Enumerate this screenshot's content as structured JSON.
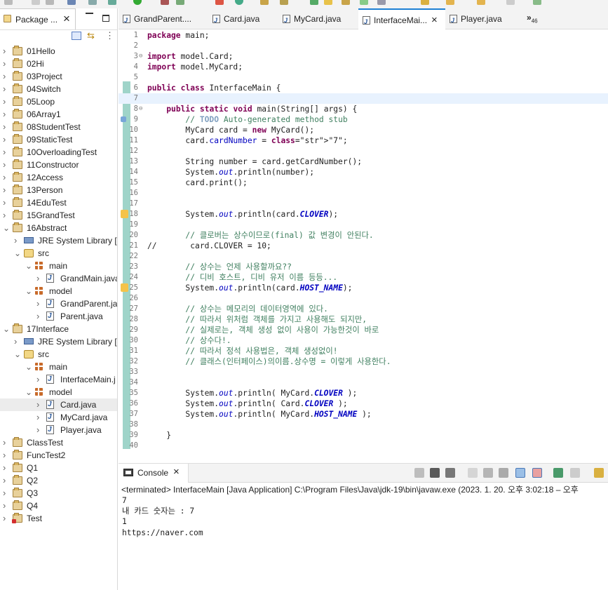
{
  "explorer": {
    "tab_label": "Package ...",
    "projects": [
      {
        "name": "01Hello",
        "error": false
      },
      {
        "name": "02Hi",
        "error": false
      },
      {
        "name": "03Project",
        "error": false
      },
      {
        "name": "04Switch",
        "error": false
      },
      {
        "name": "05Loop",
        "error": false
      },
      {
        "name": "06Array1",
        "error": false
      },
      {
        "name": "08StudentTest",
        "error": false
      },
      {
        "name": "09StaticTest",
        "error": false
      },
      {
        "name": "10OverloadingTest",
        "error": false
      },
      {
        "name": "11Constructor",
        "error": false
      },
      {
        "name": "12Access",
        "error": false
      },
      {
        "name": "13Person",
        "error": false
      },
      {
        "name": "14EduTest",
        "error": false
      },
      {
        "name": "15GrandTest",
        "error": false
      }
    ],
    "abstract_project": "16Abstract",
    "abstract_children": {
      "jre": "JRE System Library [J",
      "src": "src",
      "pkg_main": "main",
      "main_files": [
        "GrandMain.java"
      ],
      "pkg_model": "model",
      "model_files": [
        "GrandParent.jav",
        "Parent.java"
      ]
    },
    "interface_project": "17Interface",
    "interface_children": {
      "jre": "JRE System Library [J",
      "src": "src",
      "pkg_main": "main",
      "main_files": [
        "InterfaceMain.j"
      ],
      "pkg_model": "model",
      "model_files": [
        "Card.java",
        "MyCard.java",
        "Player.java"
      ]
    },
    "after_projects": [
      {
        "name": "ClassTest",
        "error": false
      },
      {
        "name": "FuncTest2",
        "error": false
      },
      {
        "name": "Q1",
        "error": false
      },
      {
        "name": "Q2",
        "error": false
      },
      {
        "name": "Q3",
        "error": false
      },
      {
        "name": "Q4",
        "error": false
      },
      {
        "name": "Test",
        "error": true
      }
    ]
  },
  "editor": {
    "tabs": [
      "GrandParent....",
      "Card.java",
      "MyCard.java",
      "InterfaceMai...",
      "Player.java"
    ],
    "active_tab": 3,
    "overflow_label": "»",
    "overflow_count": "46",
    "code": [
      "package main;",
      "",
      "import model.Card;",
      "import model.MyCard;",
      "",
      "public class InterfaceMain {",
      "",
      "    public static void main(String[] args) {",
      "        // TODO Auto-generated method stub",
      "        MyCard card = new MyCard();",
      "        card.cardNumber = \"7\";",
      "",
      "        String number = card.getCardNumber();",
      "        System.out.println(number);",
      "        card.print();",
      "",
      "",
      "        System.out.println(card.CLOVER);",
      "",
      "        // 클로버는 상수이므로(final) 값 변경이 안된다.",
      "//       card.CLOVER = 10;",
      "",
      "        // 상수는 언제 사용할까요??",
      "        // 디비 호스트, 디비 유저 이름 등등...",
      "        System.out.println(card.HOST_NAME);",
      "",
      "        // 상수는 메모리의 데이터영역에 있다.",
      "        // 따라서 위처럼 객체를 가지고 사용해도 되지만,",
      "        // 실제로는, 객체 생성 없이 사용이 가능한것이 바로",
      "        // 상수다!.",
      "        // 따라서 정석 사용법은, 객체 생성없이!",
      "        // 클래스(인터페이스)의이름.상수명 = 이렇게 사용한다.",
      "",
      "",
      "        System.out.println( MyCard.CLOVER );",
      "        System.out.println( Card.CLOVER );",
      "        System.out.println( MyCard.HOST_NAME );",
      "",
      "    }",
      ""
    ]
  },
  "console": {
    "tab_label": "Console",
    "status": "<terminated> InterfaceMain [Java Application] C:\\Program Files\\Java\\jdk-19\\bin\\javaw.exe  (2023. 1. 20. 오후 3:02:18 – 오후",
    "output": [
      "7",
      "내 카드 숫자는 : 7",
      "1",
      "https://naver.com"
    ]
  }
}
